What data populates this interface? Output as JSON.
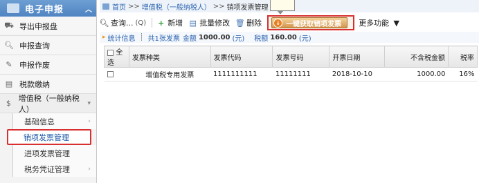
{
  "sidebar": {
    "header_title": "电子申报",
    "items": [
      {
        "label": "导出申报盘"
      },
      {
        "label": "申报查询"
      },
      {
        "label": "申报作废"
      },
      {
        "label": "税款缴纳"
      },
      {
        "label": "增值税（一般纳税人）"
      }
    ],
    "subitems": [
      {
        "label": "基础信息"
      },
      {
        "label": "销项发票管理"
      },
      {
        "label": "进项发票管理"
      },
      {
        "label": "税务凭证管理"
      }
    ]
  },
  "breadcrumb": {
    "home": "首页",
    "sep1": ">>",
    "level1": "增值税（一般纳税人）",
    "sep2": ">>",
    "current": "销项发票管理"
  },
  "toolbar": {
    "query_label": "查询...",
    "query_shortcut": "(Q)",
    "add_label": "新增",
    "batch_edit_label": "批量修改",
    "delete_label": "删除",
    "primary_label": "一键获取销项发票",
    "more_label": "更多功能"
  },
  "stats": {
    "title": "统计信息",
    "count_text": "共1张发票",
    "amount_label": "金额",
    "amount_value": "1000.00",
    "amount_unit": "(元)",
    "tax_label": "税额",
    "tax_value": "160.00",
    "tax_unit": "(元)"
  },
  "table": {
    "headers": [
      "全选",
      "发票种类",
      "发票代码",
      "发票号码",
      "开票日期",
      "不含税金额",
      "税率"
    ],
    "rows": [
      [
        "",
        "增值税专用发票",
        "1111111111",
        "11111111",
        "2018-10-10",
        "1000.00",
        "16%"
      ]
    ]
  }
}
